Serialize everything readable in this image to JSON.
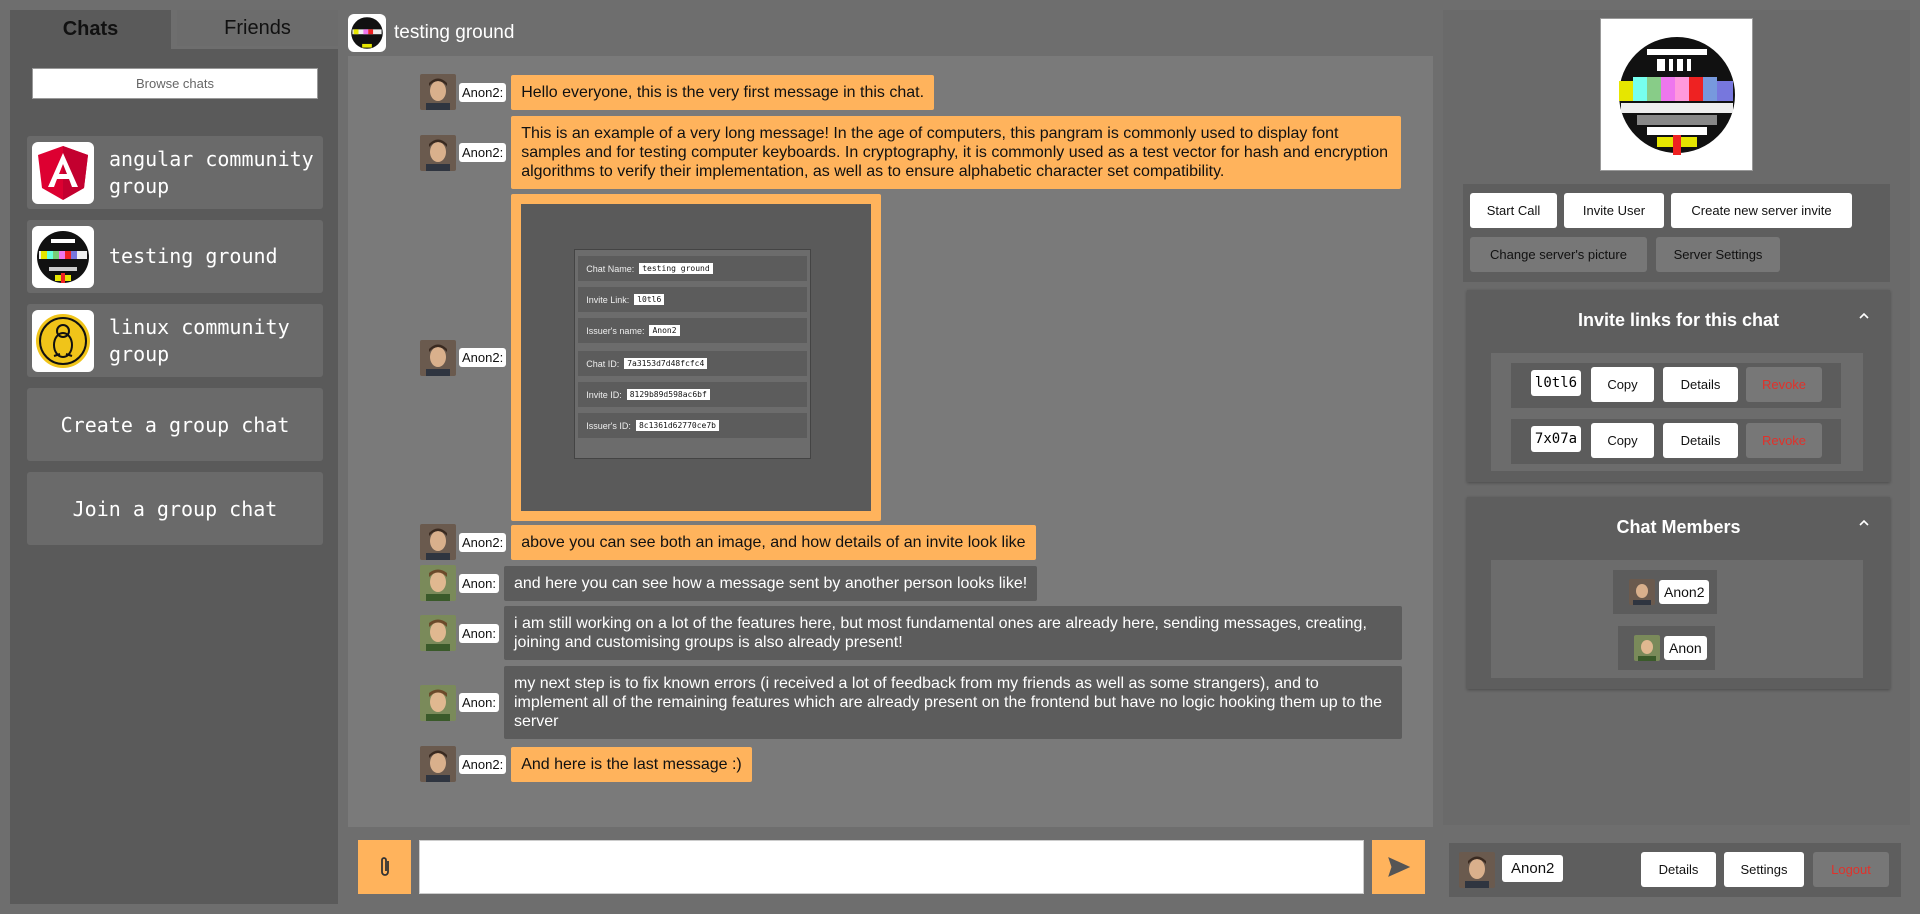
{
  "tabs": [
    {
      "label": "Chats"
    },
    {
      "label": "Friends"
    }
  ],
  "browse_label": "Browse chats",
  "chats": [
    {
      "label": "angular community group",
      "icon": "angular-icon"
    },
    {
      "label": "testing ground",
      "icon": "test-pattern-icon"
    },
    {
      "label": "linux community group",
      "icon": "tux-icon"
    }
  ],
  "chat_actions": {
    "create": "Create a group chat",
    "join": "Join a group chat"
  },
  "header": {
    "title": "testing ground"
  },
  "messages": [
    {
      "user": "Anon2:",
      "mine": true,
      "text": "Hello everyone, this is the very first message in this chat."
    },
    {
      "user": "Anon2:",
      "mine": true,
      "text": "This is an example of a very long message! In the age of computers, this pangram is commonly used to display font samples and for testing computer keyboards. In cryptography, it is commonly used as a test vector for hash and encryption algorithms to verify their implementation, as well as to ensure alphabetic character set compatibility."
    },
    {
      "user": "Anon2:",
      "mine": true,
      "image": true
    },
    {
      "user": "Anon2:",
      "mine": true,
      "text": "above you can see both an image, and how details of an invite look like"
    },
    {
      "user": "Anon:",
      "mine": false,
      "text": "and here you can see how a message sent by another person looks like!"
    },
    {
      "user": "Anon:",
      "mine": false,
      "text": "i am still working on a lot of the features here, but most fundamental ones are already here, sending messages, creating, joining and customising groups is also already present!"
    },
    {
      "user": "Anon:",
      "mine": false,
      "text": "my next step is to fix known errors (i received a lot of feedback from my friends as well as some strangers), and to implement all of the remaining features which are already present on the frontend but have no logic hooking them up to the server"
    },
    {
      "user": "Anon2:",
      "mine": true,
      "text": "And here is the last message :)"
    }
  ],
  "invite_card": [
    {
      "label": "Chat Name:",
      "value": "testing ground"
    },
    {
      "label": "Invite Link:",
      "value": "l0tl6"
    },
    {
      "label": "Issuer's name:",
      "value": "Anon2"
    },
    {
      "label": "Chat ID:",
      "value": "7a3153d7d48fcfc4"
    },
    {
      "label": "Invite ID:",
      "value": "8129b89d598ac6bf"
    },
    {
      "label": "Issuer's ID:",
      "value": "8c1361d62770ce7b"
    }
  ],
  "right": {
    "actions": {
      "start_call": "Start Call",
      "invite_user": "Invite User",
      "create_invite": "Create new server invite",
      "change_picture": "Change server's picture",
      "server_settings": "Server Settings"
    },
    "invites_title": "Invite links for this chat",
    "invites": [
      {
        "code": "l0tl6",
        "copy": "Copy",
        "details": "Details",
        "revoke": "Revoke"
      },
      {
        "code": "7x07a",
        "copy": "Copy",
        "details": "Details",
        "revoke": "Revoke"
      }
    ],
    "members_title": "Chat Members",
    "members": [
      {
        "name": "Anon2"
      },
      {
        "name": "Anon"
      }
    ]
  },
  "userbar": {
    "name": "Anon2",
    "details": "Details",
    "settings": "Settings",
    "logout": "Logout"
  },
  "colors": {
    "accent": "#ffb35c",
    "danger": "#e0322b"
  }
}
